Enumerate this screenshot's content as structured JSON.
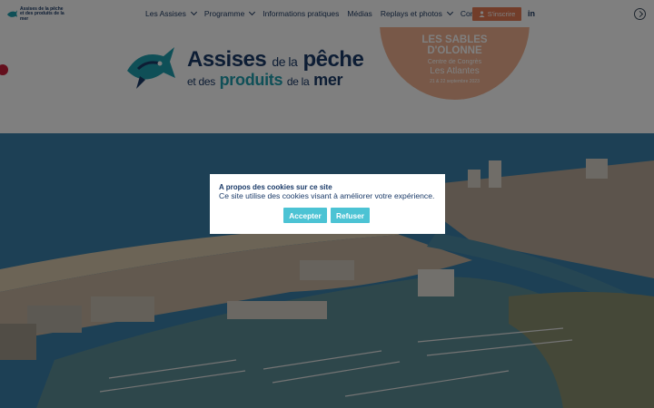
{
  "site": {
    "nav_logo_line1": "Assises de la pêche",
    "nav_logo_line2": "et des produits de la mer"
  },
  "nav": {
    "items": [
      {
        "label": "Les Assises",
        "has_dropdown": true
      },
      {
        "label": "Programme",
        "has_dropdown": true
      },
      {
        "label": "Informations pratiques",
        "has_dropdown": false
      },
      {
        "label": "Médias",
        "has_dropdown": false
      },
      {
        "label": "Replays et photos",
        "has_dropdown": true
      },
      {
        "label": "Contact",
        "has_dropdown": false
      }
    ],
    "register_label": "S'inscrire",
    "register_icon": "user-icon",
    "linkedin_label": "in",
    "login_icon": "login-icon",
    "accent_color": "#e57a54"
  },
  "banner": {
    "logo": {
      "w1": "Assises",
      "w2": "de la",
      "w3": "pêche",
      "w4": "et des",
      "w5": "produits",
      "w6": "de la",
      "w7": "mer"
    },
    "event": {
      "city_line1": "LES SABLES",
      "city_line2": "D'OLONNE",
      "venue_prefix": "Centre de Congrès",
      "venue": "Les Atlantes",
      "dates": "21 & 22 septembre 2023"
    },
    "circle_color": "#f0b190"
  },
  "cookie": {
    "title": "A propos des cookies sur ce site",
    "text": "Ce site utilise des cookies visant à améliorer votre expérience.",
    "accept_label": "Accepter",
    "refuse_label": "Refuser",
    "button_color": "#4cc3d4"
  }
}
